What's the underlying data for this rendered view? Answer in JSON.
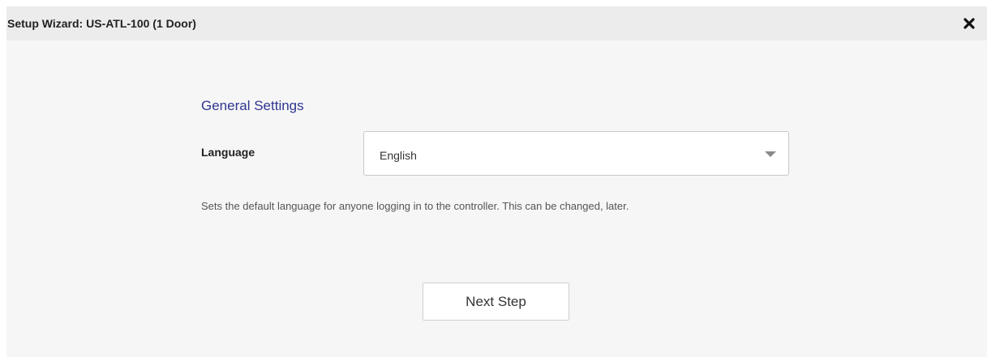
{
  "dialog": {
    "title": "Setup Wizard: US-ATL-100 (1 Door)",
    "close_icon": "close-icon"
  },
  "general_settings": {
    "heading": "General Settings",
    "language": {
      "label": "Language",
      "value": "English",
      "caret_icon": "chevron-down-icon"
    },
    "help_text": "Sets the default language for anyone logging in to the controller. This can be changed, later."
  },
  "actions": {
    "next_label": "Next Step"
  },
  "colors": {
    "heading": "#2f3590",
    "dialog_bg": "#f6f6f6",
    "titlebar_bg": "#ececec"
  }
}
